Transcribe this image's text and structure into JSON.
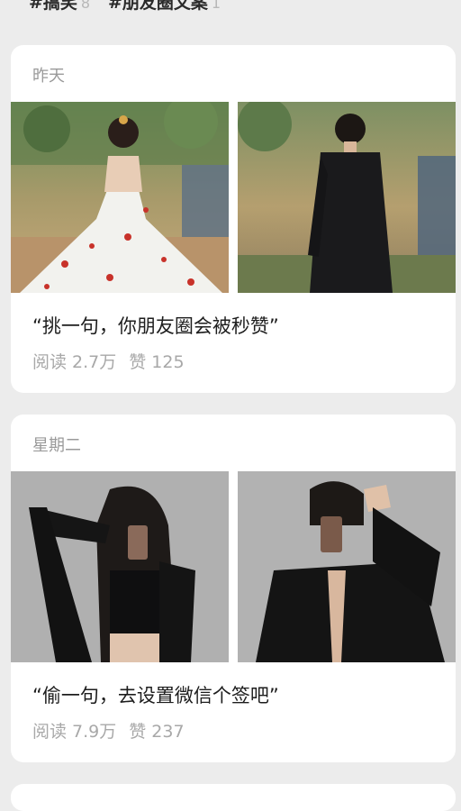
{
  "topic_tags": [
    {
      "label": "#搞笑",
      "count": "8"
    },
    {
      "label": "#朋友圈文案",
      "count": "1"
    }
  ],
  "posts": [
    {
      "day": "昨天",
      "quote": "“挑一句，你朋友圈会被秒赞”",
      "reads": "阅读 2.7万",
      "likes": "赞 125"
    },
    {
      "day": "星期二",
      "quote": "“偷一句，去设置微信个签吧”",
      "reads": "阅读 7.9万",
      "likes": "赞 237"
    }
  ],
  "colors": {
    "page_bg": "#ececec",
    "card_bg": "#ffffff",
    "muted_text": "#9a9a9a",
    "body_text": "#1d1d1d"
  }
}
